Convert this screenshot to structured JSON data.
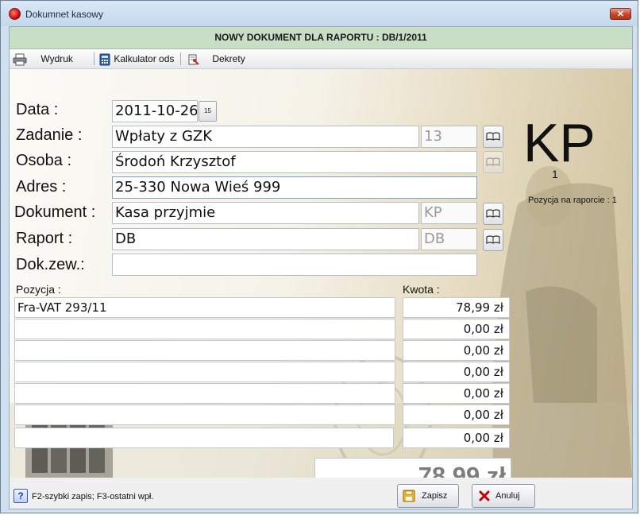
{
  "window": {
    "title": "Dokumnet kasowy",
    "close_symbol": "✕",
    "header": "NOWY DOKUMENT DLA RAPORTU : DB/1/2011"
  },
  "toolbar": {
    "print_label": "Wydruk",
    "calculator_label": "Kalkulator ods",
    "decrees_label": "Dekrety"
  },
  "form": {
    "labels": {
      "date": "Data :",
      "task": "Zadanie :",
      "person": "Osoba :",
      "address": "Adres :",
      "document": "Dokument :",
      "report": "Raport :",
      "ext_doc": "Dok.zew.:",
      "position": "Pozycja :",
      "amount": "Kwota :"
    },
    "values": {
      "date": "2011-10-26",
      "calendar_icon_text": "15",
      "task": "Wpłaty z GZK",
      "task_code": "13",
      "person": "Środoń Krzysztof",
      "address": "25-330 Nowa Wieś 999",
      "document": "Kasa przyjmie",
      "document_code": "KP",
      "report": "DB",
      "report_code": "DB",
      "ext_doc": ""
    }
  },
  "doc_type": {
    "code": "KP",
    "number": "1",
    "report_position": "Pozycja na raporcie : 1"
  },
  "items": [
    {
      "position": "Fra-VAT 293/11",
      "amount": "78,99 zł"
    },
    {
      "position": "",
      "amount": "0,00 zł"
    },
    {
      "position": "",
      "amount": "0,00 zł"
    },
    {
      "position": "",
      "amount": "0,00 zł"
    },
    {
      "position": "",
      "amount": "0,00 zł"
    },
    {
      "position": "",
      "amount": "0,00 zł"
    },
    {
      "position": "",
      "amount": "0,00 zł"
    }
  ],
  "total": "78,99 zł",
  "footer": {
    "help_icon_text": "?",
    "help_text": "F2-szybki zapis; F3-ostatni wpł.",
    "save_label": "Zapisz",
    "cancel_label": "Anuluj"
  },
  "colors": {
    "header_bg": "#c9dfc5",
    "window_frame": "#cfe0f1",
    "cancel_icon": "#c40000",
    "accent_line": "#2f8f2f"
  }
}
